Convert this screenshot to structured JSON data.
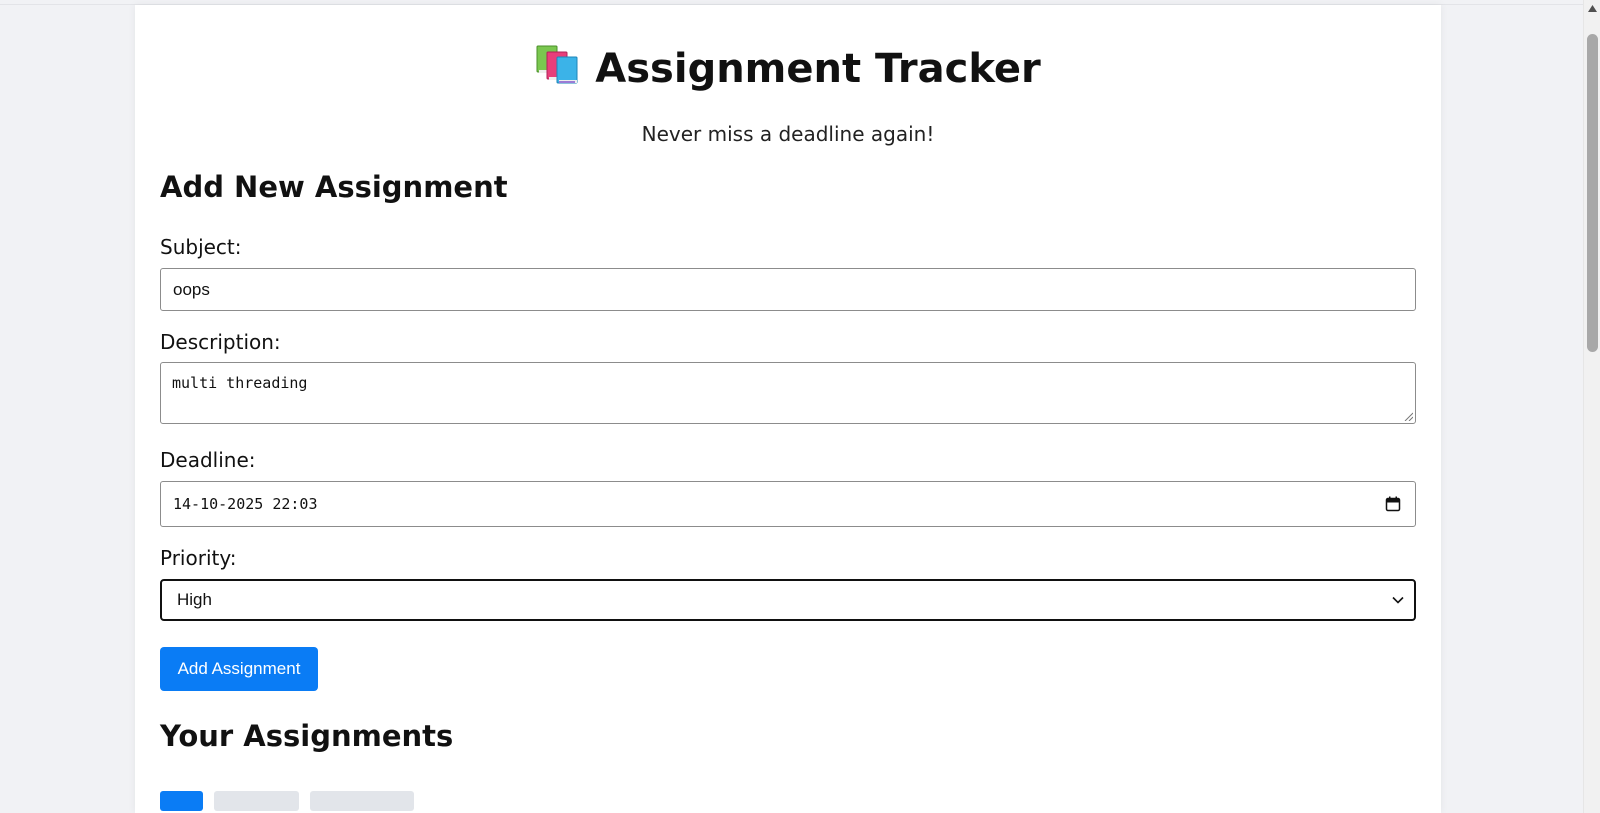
{
  "header": {
    "title": "Assignment Tracker",
    "icon": "books-icon",
    "subtitle": "Never miss a deadline again!"
  },
  "form": {
    "heading": "Add New Assignment",
    "subject": {
      "label": "Subject:",
      "value": "oops"
    },
    "description": {
      "label": "Description:",
      "value": "multi threading"
    },
    "deadline": {
      "label": "Deadline:",
      "value": "14-10-2025 22:03"
    },
    "priority": {
      "label": "Priority:",
      "value": "High"
    },
    "submit_label": "Add Assignment"
  },
  "list": {
    "heading": "Your Assignments"
  },
  "colors": {
    "accent": "#0a7cf5",
    "page_bg": "#f1f2f5",
    "card_bg": "#ffffff"
  }
}
